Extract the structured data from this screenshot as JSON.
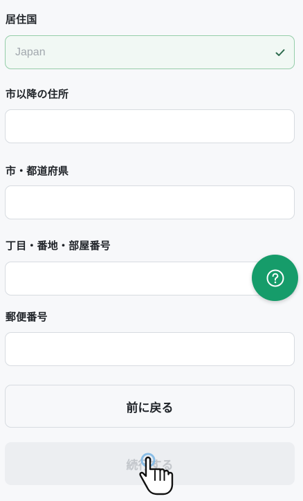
{
  "form": {
    "country": {
      "label": "居住国",
      "value": "Japan"
    },
    "address_after_city": {
      "label": "市以降の住所",
      "value": ""
    },
    "prefecture": {
      "label": "市・都道府県",
      "value": ""
    },
    "street": {
      "label": "丁目・番地・部屋番号",
      "value": ""
    },
    "postal_code": {
      "label": "郵便番号",
      "value": ""
    }
  },
  "buttons": {
    "back_label": "前に戻る",
    "continue_label": "続行する"
  },
  "colors": {
    "accent": "#169c6a",
    "validated_border": "#95cda9",
    "validated_bg": "#f1f8f4"
  },
  "icons": {
    "check": "check-icon",
    "help": "help-circle-icon",
    "cursor": "hand-pointer-icon"
  }
}
